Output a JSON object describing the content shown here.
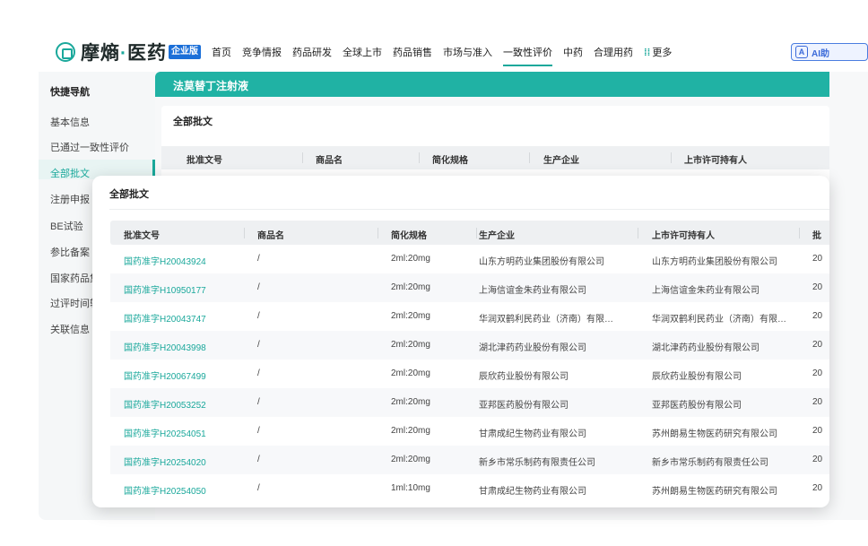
{
  "brand": {
    "name_part1": "摩熵",
    "dot": "·",
    "name_part2": "医药",
    "badge": "企业版"
  },
  "nav": {
    "items": [
      "首页",
      "竞争情报",
      "药品研发",
      "全球上市",
      "药品销售",
      "市场与准入",
      "一致性评价",
      "中药",
      "合理用药"
    ],
    "active": "一致性评价",
    "more_label": "更多",
    "ai_label": "AI助"
  },
  "sidebar": {
    "title": "快捷导航",
    "items": [
      "基本信息",
      "已通过一致性评价",
      "全部批文",
      "注册申报",
      "BE试验",
      "参比备案",
      "国家药品集",
      "过评时间轴",
      "关联信息"
    ],
    "active_index": 2
  },
  "drug": {
    "name": "法莫替丁注射液"
  },
  "background_card": {
    "title": "全部批文",
    "columns": [
      "批准文号",
      "商品名",
      "简化规格",
      "生产企业",
      "上市许可持有人"
    ]
  },
  "modal": {
    "title": "全部批文",
    "columns": [
      "批准文号",
      "商品名",
      "简化规格",
      "生产企业",
      "上市许可持有人",
      "批"
    ],
    "rows": [
      [
        "国药准字H20043924",
        "/",
        "2ml:20mg",
        "山东方明药业集团股份有限公司",
        "山东方明药业集团股份有限公司",
        "20"
      ],
      [
        "国药准字H10950177",
        "/",
        "2ml:20mg",
        "上海信谊金朱药业有限公司",
        "上海信谊金朱药业有限公司",
        "20"
      ],
      [
        "国药准字H20043747",
        "/",
        "2ml:20mg",
        "华润双鹤利民药业（济南）有限…",
        "华润双鹤利民药业（济南）有限…",
        "20"
      ],
      [
        "国药准字H20043998",
        "/",
        "2ml:20mg",
        "湖北津药药业股份有限公司",
        "湖北津药药业股份有限公司",
        "20"
      ],
      [
        "国药准字H20067499",
        "/",
        "2ml:20mg",
        "辰欣药业股份有限公司",
        "辰欣药业股份有限公司",
        "20"
      ],
      [
        "国药准字H20053252",
        "/",
        "2ml:20mg",
        "亚邦医药股份有限公司",
        "亚邦医药股份有限公司",
        "20"
      ],
      [
        "国药准字H20254051",
        "/",
        "2ml:20mg",
        "甘肃成纪生物药业有限公司",
        "苏州朗易生物医药研究有限公司",
        "20"
      ],
      [
        "国药准字H20254020",
        "/",
        "2ml:20mg",
        "新乡市常乐制药有限责任公司",
        "新乡市常乐制药有限责任公司",
        "20"
      ],
      [
        "国药准字H20254050",
        "/",
        "1ml:10mg",
        "甘肃成纪生物药业有限公司",
        "苏州朗易生物医药研究有限公司",
        "20"
      ]
    ]
  },
  "colors": {
    "accent": "#1aa89b",
    "header_bar": "#20b2a4",
    "badge": "#1b6fd8",
    "ai": "#3a6ad9"
  }
}
